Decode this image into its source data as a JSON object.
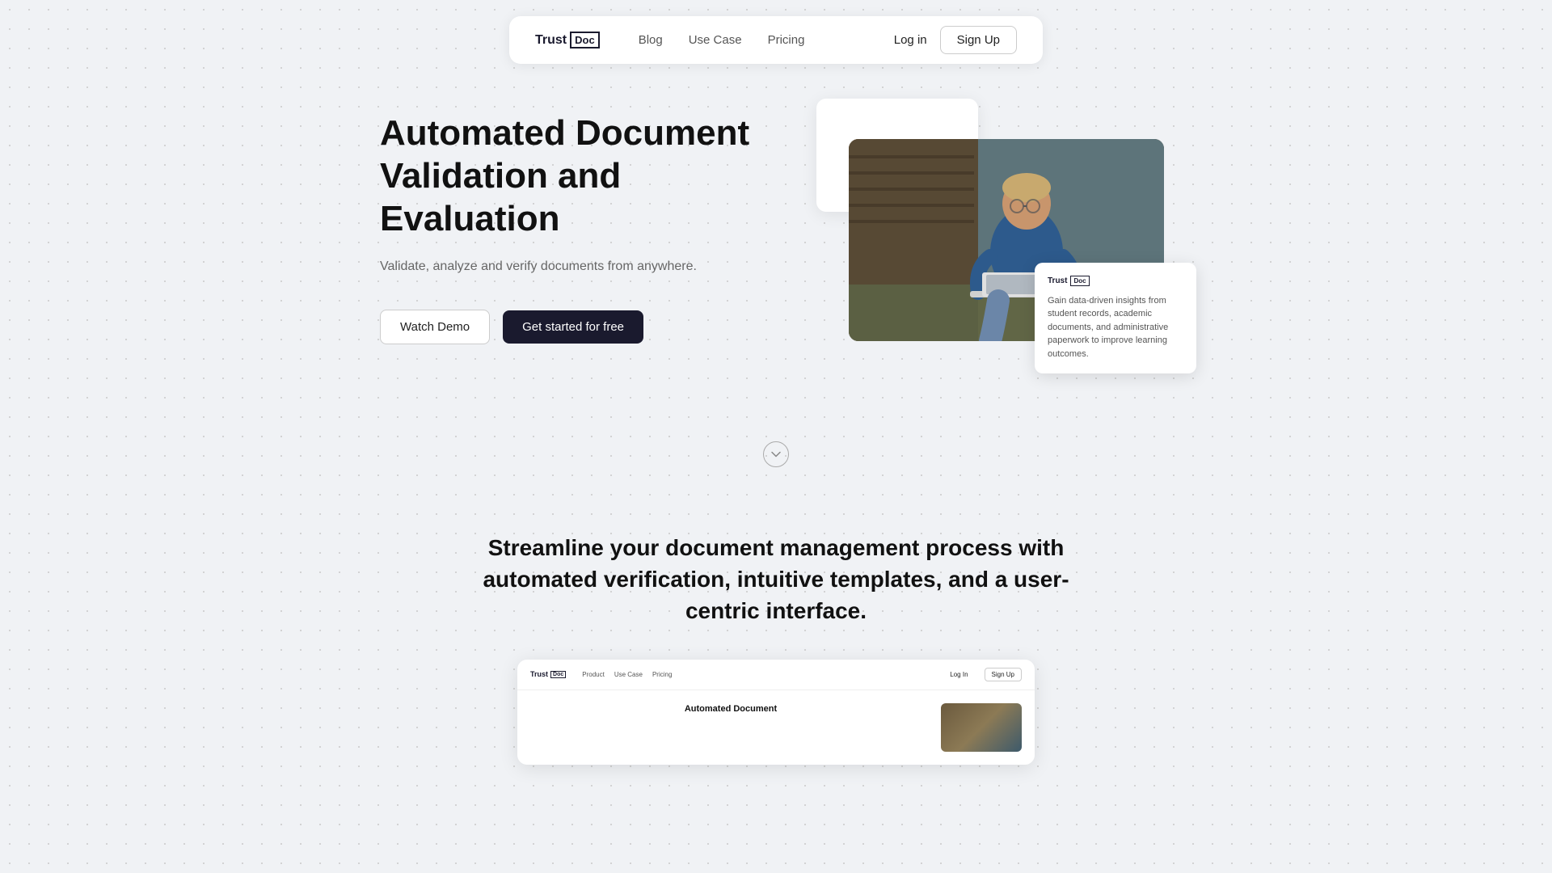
{
  "navbar": {
    "logo_trust": "Trust",
    "logo_doc": "Doc",
    "links": [
      {
        "label": "Blog",
        "id": "blog"
      },
      {
        "label": "Use Case",
        "id": "use-case"
      },
      {
        "label": "Pricing",
        "id": "pricing"
      }
    ],
    "login_label": "Log in",
    "signup_label": "Sign Up"
  },
  "hero": {
    "title": "Automated Document Validation and Evaluation",
    "subtitle": "Validate, analyze and verify documents from anywhere.",
    "watch_demo_label": "Watch Demo",
    "get_started_label": "Get started for free"
  },
  "info_card": {
    "logo_trust": "Trust",
    "logo_doc": "Doc",
    "text": "Gain data-driven insights from student records, academic documents, and administrative paperwork to improve learning outcomes."
  },
  "section_two": {
    "title": "Streamline your document management process with automated verification, intuitive templates, and a user-centric interface.",
    "mini_nav": {
      "logo_trust": "Trust",
      "logo_doc": "Doc",
      "links": [
        "Product",
        "Use Case",
        "Pricing"
      ],
      "login": "Log In",
      "signup": "Sign Up"
    },
    "mini_hero_title": "Automated Document"
  },
  "scroll_indicator": {
    "icon": "chevron-down"
  }
}
